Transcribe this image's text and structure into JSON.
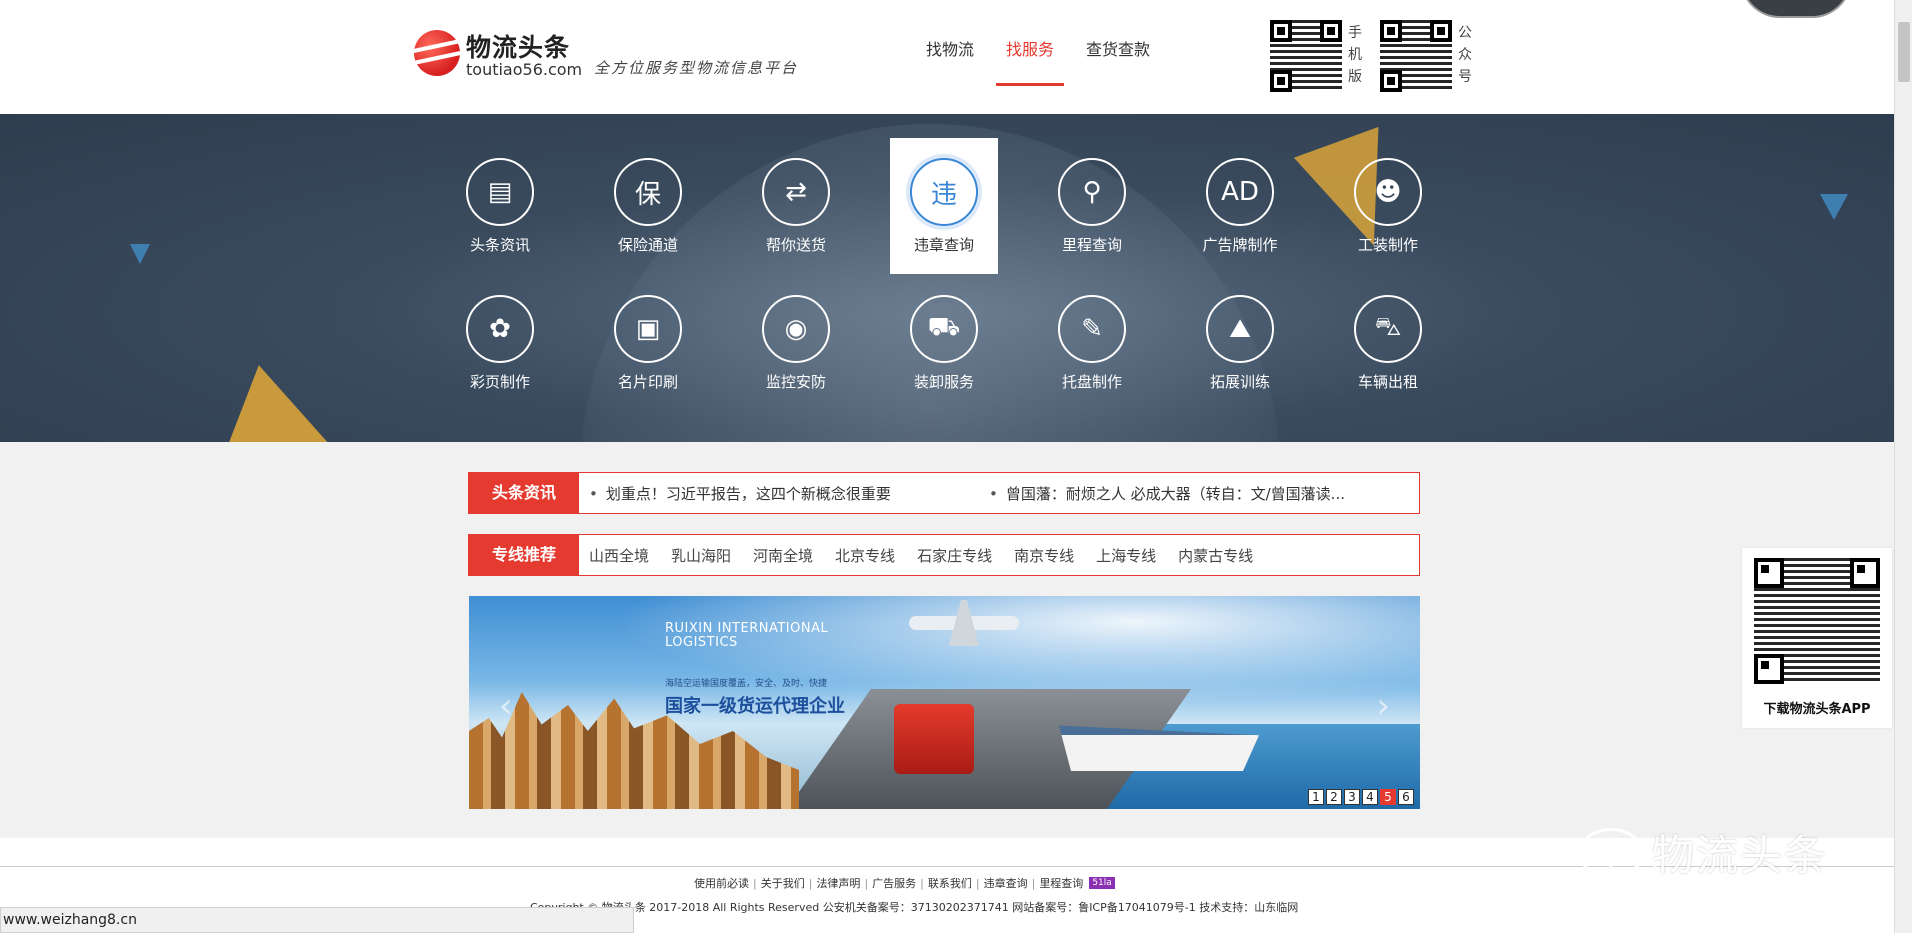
{
  "header": {
    "logo_cn": "物流头条",
    "logo_en": "toutiao56.com",
    "slogan": "全方位服务型物流信息平台",
    "nav": [
      "找物流",
      "找服务",
      "查货查款"
    ],
    "nav_active": 1,
    "qr_labels": [
      "手机版",
      "公众号"
    ]
  },
  "services": [
    {
      "label": "头条资讯",
      "icon": "newspaper-icon",
      "glyph": "▤"
    },
    {
      "label": "保险通道",
      "icon": "shield-icon",
      "glyph": "保"
    },
    {
      "label": "帮你送货",
      "icon": "delivery-box-icon",
      "glyph": "⇄"
    },
    {
      "label": "违章查询",
      "icon": "violation-search-icon",
      "glyph": "违",
      "active": true
    },
    {
      "label": "里程查询",
      "icon": "map-pin-icon",
      "glyph": "⚲"
    },
    {
      "label": "广告牌制作",
      "icon": "billboard-icon",
      "glyph": "AD"
    },
    {
      "label": "工装制作",
      "icon": "worker-icon",
      "glyph": "☻"
    },
    {
      "label": "彩页制作",
      "icon": "palette-icon",
      "glyph": "✿"
    },
    {
      "label": "名片印刷",
      "icon": "business-card-icon",
      "glyph": "▣"
    },
    {
      "label": "监控安防",
      "icon": "camera-icon",
      "glyph": "◉"
    },
    {
      "label": "装卸服务",
      "icon": "truck-icon",
      "glyph": "⛟"
    },
    {
      "label": "托盘制作",
      "icon": "pallet-icon",
      "glyph": "✎"
    },
    {
      "label": "拓展训练",
      "icon": "climbing-icon",
      "glyph": "⛰"
    },
    {
      "label": "车辆出租",
      "icon": "car-icon",
      "glyph": "⛍"
    }
  ],
  "news_bar": {
    "title": "头条资讯",
    "items": [
      "划重点！习近平报告，这四个新概念很重要",
      "曾国藩：耐烦之人 必成大器（转自：文/曾国藩读..."
    ]
  },
  "routes_bar": {
    "title": "专线推荐",
    "items": [
      "山西全境",
      "乳山海阳",
      "河南全境",
      "北京专线",
      "石家庄专线",
      "南京专线",
      "上海专线",
      "内蒙古专线"
    ]
  },
  "slide": {
    "company": "RUIXIN INTERNATIONAL LOGISTICS",
    "sub": "海陆空运输国度覆盖，安全、及时、快捷",
    "headline": "国家一级货运代理企业",
    "pages": [
      "1",
      "2",
      "3",
      "4",
      "5",
      "6"
    ],
    "active_page": 5
  },
  "side_qr": {
    "label": "下载物流头条APP"
  },
  "footer": {
    "links": [
      "使用前必读",
      "关于我们",
      "法律声明",
      "广告服务",
      "联系我们",
      "违章查询",
      "里程查询"
    ],
    "badge": "51la",
    "copyright": "Copyright © 物流头条 2017-2018 All Rights Reserved  公安机关备案号：37130202371741 网站备案号：鲁ICP备17041079号-1 技术支持：山东临网"
  },
  "status_url": "www.weizhang8.cn",
  "watermark": "物流头条"
}
